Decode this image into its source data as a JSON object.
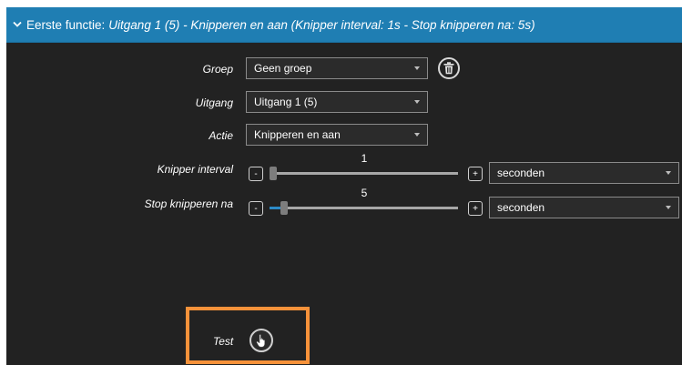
{
  "header": {
    "prefix": "Eerste functie:",
    "detail": "Uitgang 1 (5) - Knipperen en aan (Knipper interval: 1s - Stop knipperen na: 5s)"
  },
  "form": {
    "groep": {
      "label": "Groep",
      "value": "Geen groep"
    },
    "uitgang": {
      "label": "Uitgang",
      "value": "Uitgang 1 (5)"
    },
    "actie": {
      "label": "Actie",
      "value": "Knipperen en aan"
    },
    "knipper_interval": {
      "label": "Knipper interval",
      "value": "1",
      "level": 0.0,
      "minus": "-",
      "plus": "+",
      "unit": "seconden"
    },
    "stop_knipperen": {
      "label": "Stop knipperen na",
      "value": "5",
      "level": 0.06,
      "minus": "-",
      "plus": "+",
      "unit": "seconden"
    },
    "test": {
      "label": "Test"
    }
  },
  "colors": {
    "header_bg": "#1f7eb3",
    "panel_bg": "#222222",
    "highlight": "#f7923a",
    "slider_fill": "#2c8ac7"
  },
  "icons": {
    "header": "chevron-down-icon",
    "groep_action": "trash-icon",
    "test_button": "hand-pointer-icon"
  }
}
